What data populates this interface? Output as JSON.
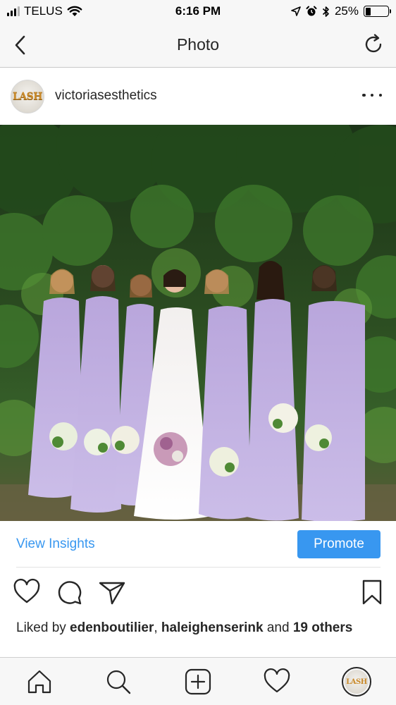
{
  "status_bar": {
    "carrier": "TELUS",
    "time": "6:16 PM",
    "battery": "25%",
    "battery_level": 0.25,
    "icons": [
      "signal-icon",
      "wifi-icon",
      "location-icon",
      "alarm-icon",
      "bluetooth-icon",
      "battery-icon"
    ]
  },
  "nav": {
    "title": "Photo",
    "back_icon": "chevron-left-icon",
    "refresh_icon": "refresh-icon"
  },
  "post": {
    "avatar_text": "LASH",
    "username": "victoriasesthetics",
    "more_icon": "more-horizontal-icon",
    "photo_subject": "photo"
  },
  "insights": {
    "view_insights_label": "View Insights",
    "promote_label": "Promote"
  },
  "actions": {
    "icons": [
      "heart-icon",
      "comment-icon",
      "share-icon",
      "bookmark-icon"
    ]
  },
  "likes": {
    "prefix": "Liked by ",
    "user1": "edenboutilier",
    "separator": ", ",
    "user2": "haleighenserink",
    "suffix_mid": " and ",
    "others_count": "19",
    "suffix_end": "others"
  },
  "tab_bar": {
    "icons": [
      "home-icon",
      "search-icon",
      "add-post-icon",
      "activity-heart-icon",
      "profile-avatar"
    ],
    "avatar_text": "LASH"
  },
  "colors": {
    "accent": "#3897f0",
    "text": "#262626",
    "bar_bg": "#f7f7f7",
    "dress": "#c2b2e0"
  }
}
